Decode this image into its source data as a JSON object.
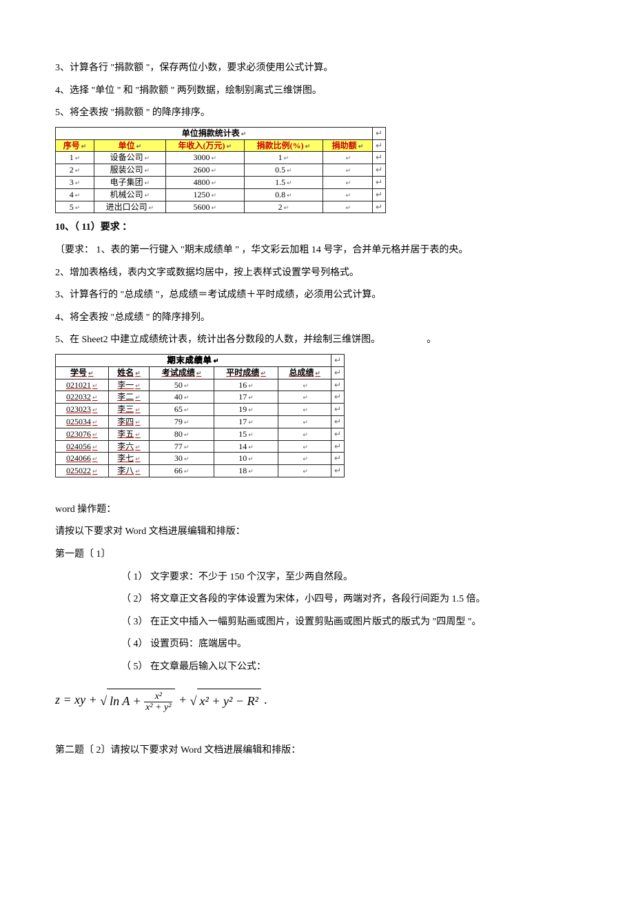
{
  "body_lines": {
    "l3": "3、计算各行 \"捐款额 \"，保存两位小数，要求必须使用公式计算。",
    "l4": "4、选择 \"单位 \" 和 \"捐款额 \" 两列数据，绘制别离式三维饼图。",
    "l5": "5、将全表按 \"捐款额 \" 的降序排序。"
  },
  "tableA": {
    "title": "单位捐款统计表",
    "headers": [
      "序号",
      "单位",
      "年收入(万元)",
      "捐款比例(%)",
      "捐助额"
    ],
    "rows": [
      [
        "1",
        "设备公司",
        "3000",
        "1",
        ""
      ],
      [
        "2",
        "服装公司",
        "2600",
        "0.5",
        ""
      ],
      [
        "3",
        "电子集团",
        "4800",
        "1.5",
        ""
      ],
      [
        "4",
        "机械公司",
        "1250",
        "0.8",
        ""
      ],
      [
        "5",
        "进出口公司",
        "5600",
        "2",
        ""
      ]
    ]
  },
  "q10": {
    "head": "10、（ 11）要求 ：",
    "l1": "〔要求： 1、表的第一行键入  \"期末成绩单 \" ，华文彩云加粗  14 号字，合并单元格并居于表的央。",
    "l2": "2、增加表格线，表内文字或数据均居中，按上表样式设置学号列格式。",
    "l3": "3、计算各行的 \"总成绩 \"，总成绩＝考试成绩＋平时成绩，必须用公式计算。",
    "l4": "4、将全表按 \"总成绩 \" 的降序排列。",
    "l5": "5、在 Sheet2 中建立成绩统计表，统计出各分数段的人数，并绘制三维饼图。",
    "l5b": "。"
  },
  "tableB": {
    "title": "期末成绩单",
    "headers": [
      "学号",
      "姓名",
      "考试成绩",
      "平时成绩",
      "总成绩"
    ],
    "rows": [
      [
        "021021",
        "李一",
        "50",
        "16",
        ""
      ],
      [
        "022032",
        "李二",
        "40",
        "17",
        ""
      ],
      [
        "023023",
        "李三",
        "65",
        "19",
        ""
      ],
      [
        "025034",
        "李四",
        "79",
        "17",
        ""
      ],
      [
        "023076",
        "李五",
        "80",
        "15",
        ""
      ],
      [
        "024056",
        "李六",
        "77",
        "14",
        ""
      ],
      [
        "024066",
        "李七",
        "30",
        "10",
        ""
      ],
      [
        "025022",
        "李八",
        "66",
        "18",
        ""
      ]
    ]
  },
  "word_section": {
    "head": "word 操作题：",
    "intro": "请按以下要求对  Word 文档进展编辑和排版：",
    "t1head": "第一题〔 1〕",
    "items": [
      "（ 1）     文字要求：不少于   150 个汉字，至少两自然段。",
      "（ 2）     将文章正文各段的字体设置为宋体，小四号，两端对齐，各段行间距为          1.5 倍。",
      "（ 3）     在正文中插入一幅剪贴画或图片，设置剪贴画或图片版式的版式为        \"四周型 \"。",
      "（ 4）     设置页码：底端居中。",
      "（ 5）     在文章最后输入以下公式："
    ],
    "formula_lhs": "z = xy +",
    "formula_part2_pre": "ln A +",
    "formula_frac_num": "x²",
    "formula_frac_den": "x² + y²",
    "formula_plus": " + ",
    "formula_sqrt2": "x² + y² − R²",
    "formula_dot": ".",
    "t2": "第二题〔 2〕请按以下要求对     Word 文档进展编辑和排版："
  }
}
